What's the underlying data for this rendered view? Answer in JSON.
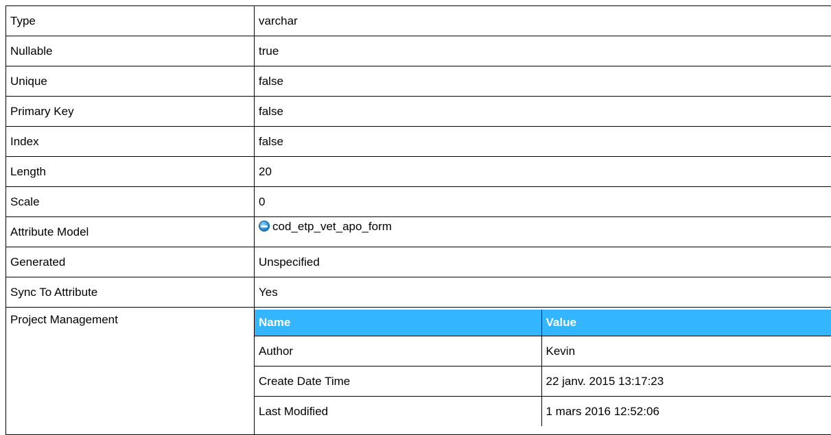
{
  "properties": [
    {
      "label": "Type",
      "value": "varchar"
    },
    {
      "label": "Nullable",
      "value": "true"
    },
    {
      "label": "Unique",
      "value": "false"
    },
    {
      "label": "Primary Key",
      "value": "false"
    },
    {
      "label": "Index",
      "value": "false"
    },
    {
      "label": "Length",
      "value": "20"
    },
    {
      "label": "Scale",
      "value": "0"
    },
    {
      "label": "Attribute Model",
      "value": "cod_etp_vet_apo_form",
      "icon": "attribute-model-icon"
    },
    {
      "label": "Generated",
      "value": "Unspecified"
    },
    {
      "label": "Sync To Attribute",
      "value": "Yes"
    }
  ],
  "project_management": {
    "label": "Project Management",
    "header": {
      "name": "Name",
      "value": "Value"
    },
    "header_color": "#33b5ff",
    "rows": [
      {
        "name": "Author",
        "value": "Kevin"
      },
      {
        "name": "Create Date Time",
        "value": "22 janv. 2015 13:17:23"
      },
      {
        "name": "Last Modified",
        "value": "1 mars 2016 12:52:06"
      }
    ]
  }
}
